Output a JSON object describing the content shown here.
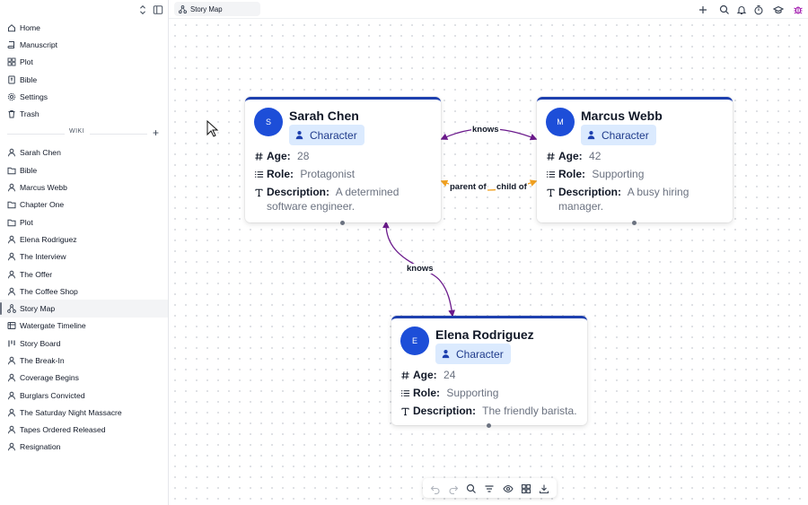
{
  "sidebar": {
    "main_nav": [
      {
        "label": "Home",
        "icon": "home-icon"
      },
      {
        "label": "Manuscript",
        "icon": "book-icon"
      },
      {
        "label": "Plot",
        "icon": "grid-icon"
      },
      {
        "label": "Bible",
        "icon": "bible-icon"
      },
      {
        "label": "Settings",
        "icon": "gear-icon"
      },
      {
        "label": "Trash",
        "icon": "trash-icon"
      }
    ],
    "wiki_label": "WIKI",
    "wiki_items": [
      {
        "label": "Sarah Chen",
        "icon": "person-icon"
      },
      {
        "label": "Bible",
        "icon": "folder-icon"
      },
      {
        "label": "Marcus Webb",
        "icon": "person-icon"
      },
      {
        "label": "Chapter One",
        "icon": "folder-icon"
      },
      {
        "label": "Plot",
        "icon": "folder-icon"
      },
      {
        "label": "Elena Rodriguez",
        "icon": "person-icon"
      },
      {
        "label": "The Interview",
        "icon": "person-icon"
      },
      {
        "label": "The Offer",
        "icon": "person-icon"
      },
      {
        "label": "The Coffee Shop",
        "icon": "person-icon"
      },
      {
        "label": "Story Map",
        "icon": "map-icon",
        "active": true
      },
      {
        "label": "Watergate Timeline",
        "icon": "timeline-icon"
      },
      {
        "label": "Story Board",
        "icon": "board-icon"
      },
      {
        "label": "The Break-In",
        "icon": "person-icon"
      },
      {
        "label": "Coverage Begins",
        "icon": "person-icon"
      },
      {
        "label": "Burglars Convicted",
        "icon": "person-icon"
      },
      {
        "label": "The Saturday Night Massacre",
        "icon": "person-icon"
      },
      {
        "label": "Tapes Ordered Released",
        "icon": "person-icon"
      },
      {
        "label": "Resignation",
        "icon": "person-icon"
      }
    ]
  },
  "tab": {
    "label": "Story Map",
    "icon": "map-icon"
  },
  "nodes": [
    {
      "id": "sarah",
      "initial": "S",
      "title": "Sarah Chen",
      "type": "Character",
      "fields": [
        {
          "key": "Age:",
          "value": "28",
          "icon": "hash-icon"
        },
        {
          "key": "Role:",
          "value": "Protagonist",
          "icon": "list-icon"
        },
        {
          "key": "Description:",
          "value": "A determined software engineer.",
          "icon": "text-icon"
        }
      ]
    },
    {
      "id": "marcus",
      "initial": "M",
      "title": "Marcus Webb",
      "type": "Character",
      "fields": [
        {
          "key": "Age:",
          "value": "42",
          "icon": "hash-icon"
        },
        {
          "key": "Role:",
          "value": "Supporting",
          "icon": "list-icon"
        },
        {
          "key": "Description:",
          "value": "A busy hiring manager.",
          "icon": "text-icon"
        }
      ]
    },
    {
      "id": "elena",
      "initial": "E",
      "title": "Elena Rodriguez",
      "type": "Character",
      "fields": [
        {
          "key": "Age:",
          "value": "24",
          "icon": "hash-icon"
        },
        {
          "key": "Role:",
          "value": "Supporting",
          "icon": "list-icon"
        },
        {
          "key": "Description:",
          "value": "The friendly barista.",
          "icon": "text-icon"
        }
      ]
    }
  ],
  "edges": [
    {
      "from": "sarah",
      "to": "marcus",
      "label": "knows",
      "color": "#6b1a8c"
    },
    {
      "from": "sarah",
      "to": "marcus",
      "label_from": "parent of",
      "label_to": "child of",
      "color": "#f0a020"
    },
    {
      "from": "sarah",
      "to": "elena",
      "label": "knows",
      "color": "#6b1a8c"
    }
  ],
  "toolbar": [
    "undo-icon",
    "redo-icon",
    "search-icon",
    "filter-icon",
    "eye-icon",
    "layout-grid-icon",
    "download-icon"
  ],
  "colors": {
    "node_accent": "#1e40af",
    "badge_bg": "#dbeafe",
    "edge_knows": "#6b1a8c",
    "edge_family": "#f0a020",
    "avatar": "#1d4ed8"
  }
}
